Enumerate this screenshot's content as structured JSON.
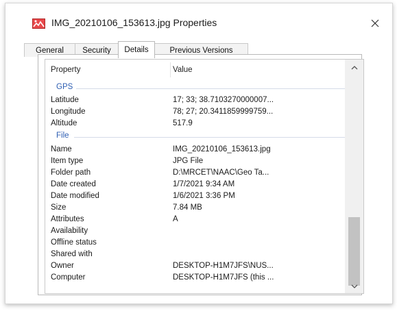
{
  "window": {
    "title": "IMG_20210106_153613.jpg Properties",
    "close_glyph": "✕"
  },
  "tabs": [
    {
      "label": "General"
    },
    {
      "label": "Security"
    },
    {
      "label": "Details"
    },
    {
      "label": "Previous Versions"
    }
  ],
  "active_tab": "Details",
  "list": {
    "columns": {
      "property": "Property",
      "value": "Value"
    },
    "groups": {
      "gps": "GPS",
      "file": "File"
    },
    "gps_rows": [
      {
        "property": "Latitude",
        "value": "17; 33; 38.7103270000007..."
      },
      {
        "property": "Longitude",
        "value": "78; 27; 20.3411859999759..."
      },
      {
        "property": "Altitude",
        "value": "517.9"
      }
    ],
    "file_rows": [
      {
        "property": "Name",
        "value": "IMG_20210106_153613.jpg"
      },
      {
        "property": "Item type",
        "value": "JPG File"
      },
      {
        "property": "Folder path",
        "value": "D:\\MRCET\\NAAC\\Geo Ta..."
      },
      {
        "property": "Date created",
        "value": "1/7/2021 9:34 AM"
      },
      {
        "property": "Date modified",
        "value": "1/6/2021 3:36 PM"
      },
      {
        "property": "Size",
        "value": "7.84 MB"
      },
      {
        "property": "Attributes",
        "value": "A"
      },
      {
        "property": "Availability",
        "value": ""
      },
      {
        "property": "Offline status",
        "value": ""
      },
      {
        "property": "Shared with",
        "value": ""
      },
      {
        "property": "Owner",
        "value": "DESKTOP-H1M7JFS\\NUS..."
      },
      {
        "property": "Computer",
        "value": "DESKTOP-H1M7JFS (this ..."
      }
    ]
  },
  "colors": {
    "group_header": "#2f5fb3",
    "scroll_thumb": "#c2c2c2"
  }
}
